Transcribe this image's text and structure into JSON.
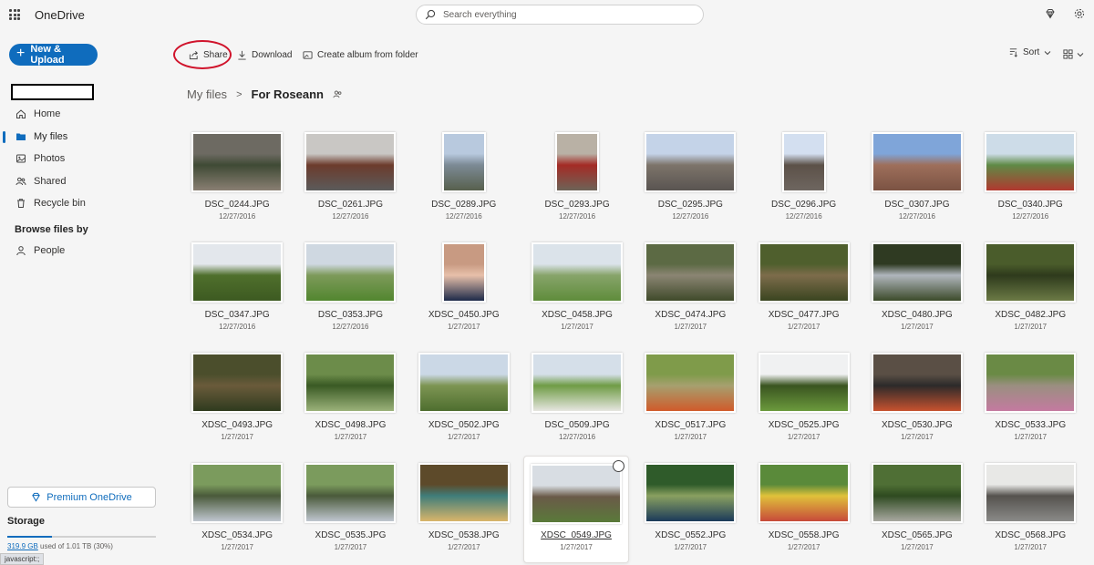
{
  "app": {
    "name": "OneDrive"
  },
  "search": {
    "placeholder": "Search everything"
  },
  "sidebar": {
    "new_button": "New & Upload",
    "nav": [
      {
        "label": "Home",
        "icon": "home-icon"
      },
      {
        "label": "My files",
        "icon": "folder-icon",
        "active": true
      },
      {
        "label": "Photos",
        "icon": "photos-icon"
      },
      {
        "label": "Shared",
        "icon": "shared-icon"
      },
      {
        "label": "Recycle bin",
        "icon": "recycle-bin-icon"
      }
    ],
    "browse_title": "Browse files by",
    "people": "People",
    "premium": "Premium OneDrive",
    "storage_title": "Storage",
    "storage_used": "319.9 GB",
    "storage_rest": " used of 1.01 TB (30%)",
    "storage_fraction": 0.3,
    "status_text": "javascript:;"
  },
  "commands": {
    "share": "Share",
    "download": "Download",
    "album": "Create album from folder",
    "sort": "Sort"
  },
  "breadcrumb": {
    "root": "My files",
    "current": "For Roseann"
  },
  "files": [
    {
      "name": "DSC_0244.JPG",
      "date": "12/27/2016",
      "orient": "land",
      "colors": [
        "#6d6a62",
        "#3f4a35",
        "#8a7f73"
      ]
    },
    {
      "name": "DSC_0261.JPG",
      "date": "12/27/2016",
      "orient": "land",
      "colors": [
        "#c9c7c4",
        "#6c3b2c",
        "#5b5b5b"
      ]
    },
    {
      "name": "DSC_0289.JPG",
      "date": "12/27/2016",
      "orient": "port",
      "colors": [
        "#b8c9de",
        "#7c8a95",
        "#57604d"
      ]
    },
    {
      "name": "DSC_0293.JPG",
      "date": "12/27/2016",
      "orient": "port",
      "colors": [
        "#b9b1a5",
        "#a42b25",
        "#6d6357"
      ]
    },
    {
      "name": "DSC_0295.JPG",
      "date": "12/27/2016",
      "orient": "land",
      "colors": [
        "#c4d3e8",
        "#7d746a",
        "#595451"
      ]
    },
    {
      "name": "DSC_0296.JPG",
      "date": "12/27/2016",
      "orient": "port",
      "colors": [
        "#d3dff0",
        "#5c5148",
        "#6e6660"
      ]
    },
    {
      "name": "DSC_0307.JPG",
      "date": "12/27/2016",
      "orient": "land",
      "colors": [
        "#7fa5d9",
        "#9e6f5b",
        "#7b5343"
      ]
    },
    {
      "name": "DSC_0340.JPG",
      "date": "12/27/2016",
      "orient": "land",
      "colors": [
        "#cddce8",
        "#5f8a46",
        "#b1382f"
      ]
    },
    {
      "name": "DSC_0347.JPG",
      "date": "12/27/2016",
      "orient": "land",
      "colors": [
        "#e3e7ec",
        "#4f6f2c",
        "#3d5a21"
      ]
    },
    {
      "name": "DSC_0353.JPG",
      "date": "12/27/2016",
      "orient": "land",
      "colors": [
        "#cfd8e1",
        "#7d9a5a",
        "#52862f"
      ]
    },
    {
      "name": "XDSC_0450.JPG",
      "date": "1/27/2017",
      "orient": "port",
      "colors": [
        "#c89a82",
        "#e7c0aa",
        "#1d2a49"
      ]
    },
    {
      "name": "XDSC_0458.JPG",
      "date": "1/27/2017",
      "orient": "land",
      "colors": [
        "#dbe3ea",
        "#87a46a",
        "#5f8c3b"
      ]
    },
    {
      "name": "XDSC_0474.JPG",
      "date": "1/27/2017",
      "orient": "land",
      "colors": [
        "#5c6a44",
        "#8b8573",
        "#3f4a2a"
      ]
    },
    {
      "name": "XDSC_0477.JPG",
      "date": "1/27/2017",
      "orient": "land",
      "colors": [
        "#4f5f2d",
        "#7d6c4b",
        "#3a4520"
      ]
    },
    {
      "name": "XDSC_0480.JPG",
      "date": "1/27/2017",
      "orient": "land",
      "colors": [
        "#2f3a22",
        "#b0b6bd",
        "#3c4a2a"
      ]
    },
    {
      "name": "XDSC_0482.JPG",
      "date": "1/27/2017",
      "orient": "land",
      "colors": [
        "#4a5c2b",
        "#2e3a1c",
        "#6b7a45"
      ]
    },
    {
      "name": "XDSC_0493.JPG",
      "date": "1/27/2017",
      "orient": "land",
      "colors": [
        "#4b4e2c",
        "#6a5b3b",
        "#2f3b1e"
      ]
    },
    {
      "name": "XDSC_0498.JPG",
      "date": "1/27/2017",
      "orient": "land",
      "colors": [
        "#6c8c4a",
        "#3a5a24",
        "#9bb27a"
      ]
    },
    {
      "name": "XDSC_0502.JPG",
      "date": "1/27/2017",
      "orient": "land",
      "colors": [
        "#cbd8e6",
        "#7d9553",
        "#4e6e2f"
      ]
    },
    {
      "name": "DSC_0509.JPG",
      "date": "12/27/2016",
      "orient": "land",
      "colors": [
        "#d5dfe9",
        "#6f9c45",
        "#e6e6e0"
      ]
    },
    {
      "name": "XDSC_0517.JPG",
      "date": "1/27/2017",
      "orient": "land",
      "colors": [
        "#7f9b4a",
        "#a6a06f",
        "#d05a2a"
      ]
    },
    {
      "name": "XDSC_0525.JPG",
      "date": "1/27/2017",
      "orient": "land",
      "colors": [
        "#f0f1f2",
        "#3a5420",
        "#6b9a3c"
      ]
    },
    {
      "name": "XDSC_0530.JPG",
      "date": "1/27/2017",
      "orient": "land",
      "colors": [
        "#5a4f45",
        "#2c2a2a",
        "#c7522f"
      ]
    },
    {
      "name": "XDSC_0533.JPG",
      "date": "1/27/2017",
      "orient": "land",
      "colors": [
        "#6a8a45",
        "#9a8f80",
        "#c47aa0"
      ]
    },
    {
      "name": "XDSC_0534.JPG",
      "date": "1/27/2017",
      "orient": "land",
      "colors": [
        "#7b9b5d",
        "#4a5a3a",
        "#bfc6cf"
      ]
    },
    {
      "name": "XDSC_0535.JPG",
      "date": "1/27/2017",
      "orient": "land",
      "colors": [
        "#7b9b5d",
        "#4a5a3a",
        "#bfc6cf"
      ]
    },
    {
      "name": "XDSC_0538.JPG",
      "date": "1/27/2017",
      "orient": "land",
      "colors": [
        "#5d4a2a",
        "#3f7d7a",
        "#d9b56a"
      ]
    },
    {
      "name": "XDSC_0549.JPG",
      "date": "1/27/2017",
      "orient": "land",
      "colors": [
        "#d8dde3",
        "#6a5a48",
        "#5a7a3a"
      ],
      "selected": true
    },
    {
      "name": "XDSC_0552.JPG",
      "date": "1/27/2017",
      "orient": "land",
      "colors": [
        "#2f5b2a",
        "#8aa060",
        "#1b3a5a"
      ]
    },
    {
      "name": "XDSC_0558.JPG",
      "date": "1/27/2017",
      "orient": "land",
      "colors": [
        "#5a8a3a",
        "#e0c23a",
        "#c74a3a"
      ]
    },
    {
      "name": "XDSC_0565.JPG",
      "date": "1/27/2017",
      "orient": "land",
      "colors": [
        "#4f6f35",
        "#2e4a20",
        "#a8a8a0"
      ]
    },
    {
      "name": "XDSC_0568.JPG",
      "date": "1/27/2017",
      "orient": "land",
      "colors": [
        "#e8e8e6",
        "#55524e",
        "#8a8a88"
      ]
    }
  ]
}
